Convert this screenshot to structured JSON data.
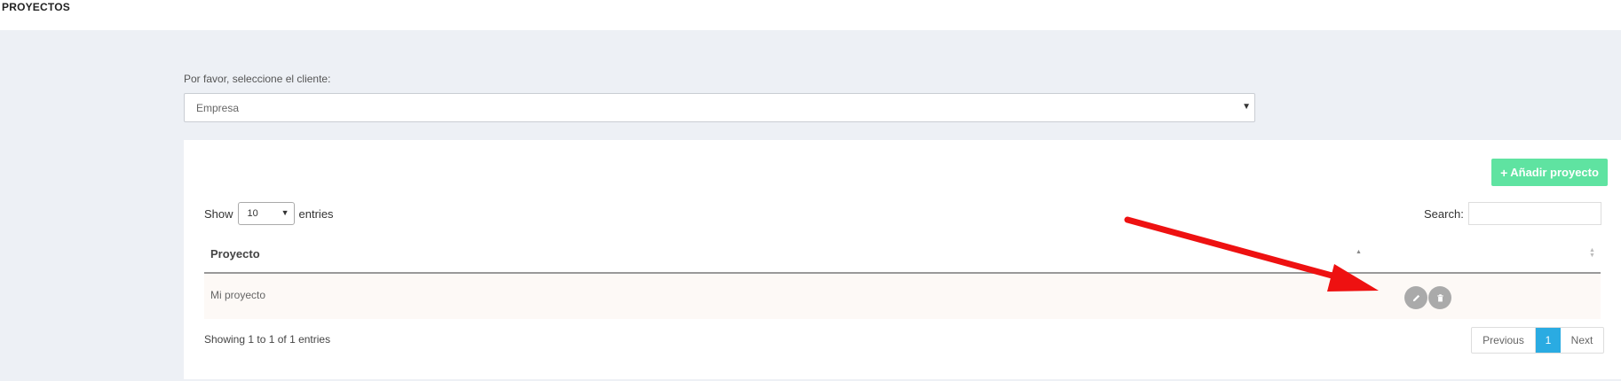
{
  "header": {
    "title": "PROYECTOS"
  },
  "client": {
    "label": "Por favor, seleccione el cliente:",
    "selected": "Empresa"
  },
  "toolbar": {
    "add_label": "Añadir proyecto"
  },
  "length": {
    "show_label": "Show",
    "value": "10",
    "entries_label": "entries"
  },
  "search": {
    "label": "Search:",
    "value": ""
  },
  "table": {
    "columns": [
      "Proyecto",
      ""
    ],
    "rows": [
      {
        "name": "Mi proyecto"
      }
    ]
  },
  "info": "Showing 1 to 1 of 1 entries",
  "pagination": {
    "previous": "Previous",
    "current": "1",
    "next": "Next"
  },
  "colors": {
    "accent_green": "#5fe3a1",
    "accent_blue": "#2aabe2",
    "annotation_red": "#ee1111"
  },
  "icons": {
    "edit": "pencil-icon",
    "delete": "trash-icon",
    "add": "plus-icon"
  }
}
